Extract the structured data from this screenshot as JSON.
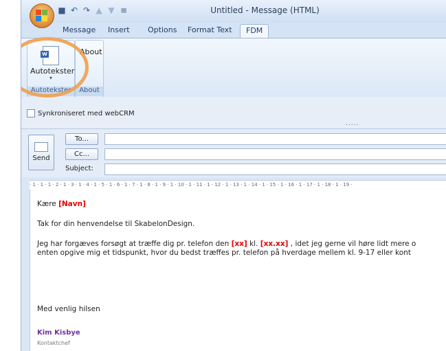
{
  "window": {
    "title": "Untitled - Message (HTML)"
  },
  "tabs": [
    "Message",
    "Insert",
    "Options",
    "Format Text",
    "FDM"
  ],
  "ribbon": {
    "groups": [
      {
        "label": "Autotekster",
        "button": "Autotekster"
      },
      {
        "label": "About",
        "button": "About"
      }
    ]
  },
  "sync": {
    "label": "Synkroniseret med webCRM",
    "dots": "....."
  },
  "header": {
    "send": "Send",
    "to": "To...",
    "cc": "Cc...",
    "subject": "Subject:"
  },
  "ruler": "· 1 · 1 · 1 · 2 · 1 · 3 · 1 · 4 · 1 · 5 · 1 · 6 · 1 · 7 · 1 · 8 · 1 · 9 · 1 · 10 · 1 · 11 · 1 · 12 · 1 · 13 · 1 · 14 · 1 · 15 · 1 · 16 · 1 · 17 · 1 · 18 · 1 · 19 ·",
  "body": {
    "greet_prefix": "Kære ",
    "greet_field": "[Navn]",
    "line1": "Tak for din henvendelse til SkabelonDesign.",
    "line2_a": "Jeg har forgæves forsøgt at træffe dig pr. telefon den ",
    "line2_field1": "[xx]",
    "line2_b": " kl. ",
    "line2_field2": "[xx.xx]",
    "line2_c": " , idet jeg gerne vil høre lidt mere o",
    "line3": "enten opgive mig et tidspunkt, hvor du bedst træffes pr. telefon på hverdage mellem kl. 9-17 eller kont",
    "closing": "Med venlig hilsen",
    "sig_name": "Kim Kisbye",
    "sig_title": "Kontaktchef"
  }
}
